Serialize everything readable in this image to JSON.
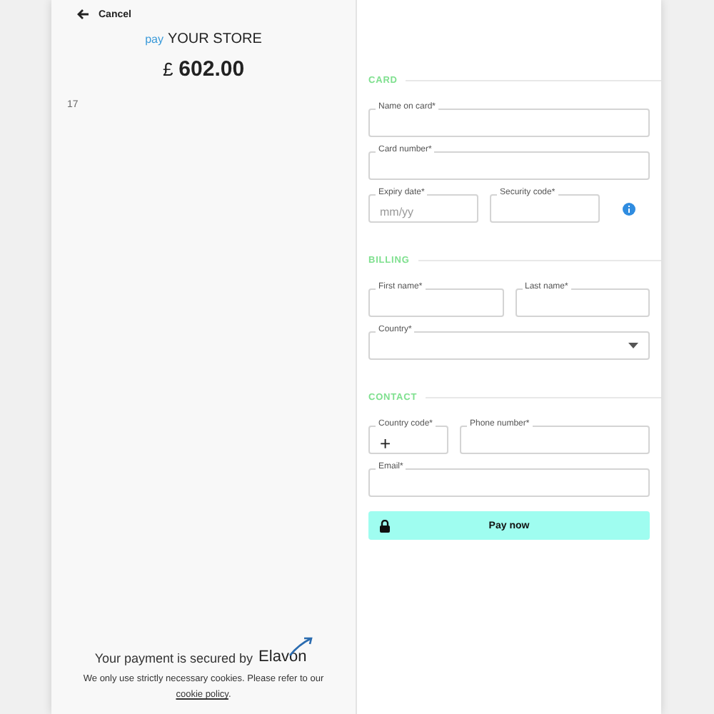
{
  "header": {
    "back_label": "Cancel",
    "brand_prefix": "pay",
    "store_name": "YOUR STORE",
    "currency": "£",
    "amount": "602.00",
    "reference": "17"
  },
  "sections": [
    {
      "title": "CARD",
      "rows": [
        [
          {
            "label": "Name on card*",
            "kind": "text"
          }
        ],
        [
          {
            "label": "Card number*",
            "kind": "text"
          }
        ],
        [
          {
            "label": "Expiry date*",
            "kind": "text",
            "placeholder": "mm/yy"
          },
          {
            "label": "Security code*",
            "kind": "text"
          },
          {
            "kind": "info"
          }
        ]
      ]
    },
    {
      "title": "BILLING",
      "rows": [
        [
          {
            "label": "First name*",
            "kind": "text"
          },
          {
            "label": "Last name*",
            "kind": "text"
          }
        ],
        [
          {
            "label": "Country*",
            "kind": "select"
          }
        ]
      ]
    },
    {
      "title": "CONTACT",
      "rows": [
        [
          {
            "label": "Country code*",
            "kind": "prefix",
            "value": "+"
          },
          {
            "label": "Phone number*",
            "kind": "text"
          }
        ],
        [
          {
            "label": "Email*",
            "kind": "text"
          }
        ]
      ]
    }
  ],
  "pay_button": "Pay now",
  "footer": {
    "secured_text": "Your payment is secured by",
    "logo_text": "Elavon",
    "cookie_text": "We only use strictly necessary cookies. Please refer to our",
    "cookie_link": "cookie policy",
    "cookie_end": "."
  }
}
